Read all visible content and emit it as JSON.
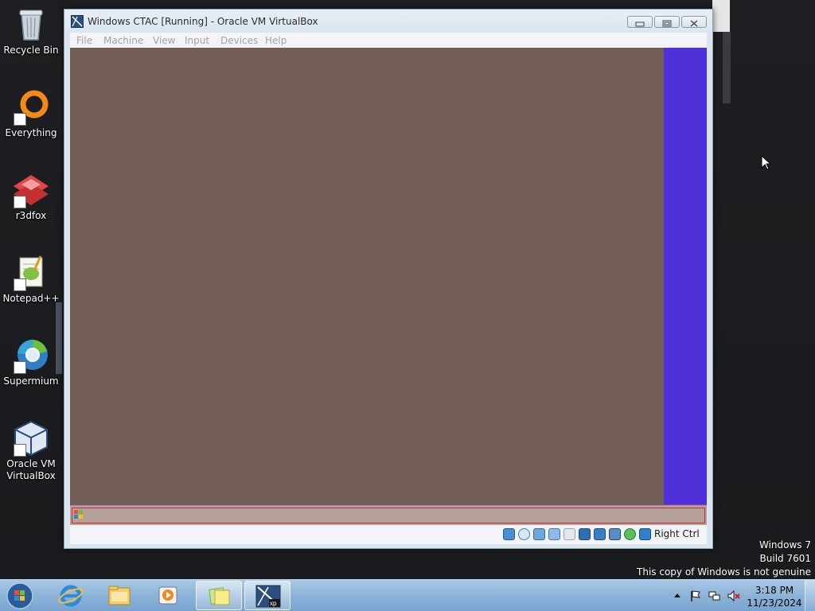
{
  "desktop": {
    "icons": [
      {
        "label": "Recycle Bin",
        "icon": "recycle-bin-icon"
      },
      {
        "label": "Everything",
        "icon": "everything-search-icon"
      },
      {
        "label": "r3dfox",
        "icon": "r3dfox-browser-icon"
      },
      {
        "label": "Notepad++",
        "icon": "notepad-plus-plus-icon"
      },
      {
        "label": "Supermium",
        "icon": "supermium-browser-icon"
      },
      {
        "label": "Oracle VM VirtualBox",
        "icon": "virtualbox-icon"
      }
    ]
  },
  "vbox": {
    "title": "Windows CTAC [Running] - Oracle VM VirtualBox",
    "menu": [
      "File",
      "Machine",
      "View",
      "Input",
      "Devices",
      "Help"
    ],
    "host_key": "Right Ctrl",
    "status_icons": [
      "hard-disk-icon",
      "optical-drive-icon",
      "network-icon",
      "usb-icon",
      "shared-folders-icon",
      "display-icon",
      "video-capture-icon",
      "cpu-icon",
      "mouse-integration-icon",
      "keyboard-capture-icon"
    ]
  },
  "watermark": {
    "line1": "Windows 7",
    "line2": "Build 7601",
    "line3": "This copy of Windows is not genuine"
  },
  "taskbar": {
    "pinned": [
      "internet-explorer-icon",
      "windows-explorer-icon",
      "media-player-icon",
      "sticky-notes-icon",
      "virtualbox-xp-icon"
    ],
    "clock_time": "3:18 PM",
    "clock_date": "11/23/2024"
  },
  "colors": {
    "vm_background": "#725e55",
    "vm_strip": "#5030d8",
    "vm_taskbar": "#b7a19b",
    "taskbar": "#8db3d8"
  }
}
